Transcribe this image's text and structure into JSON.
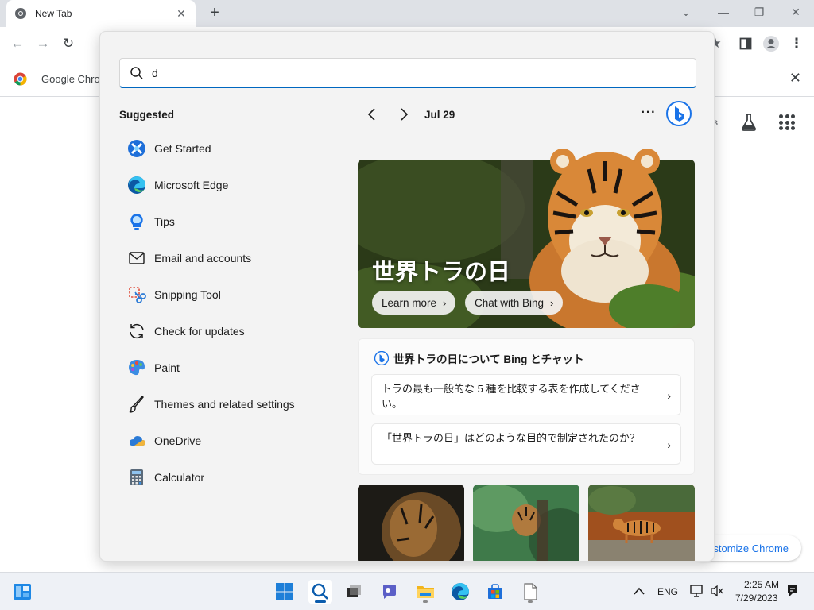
{
  "browser": {
    "tab_title": "New Tab",
    "bookmark_text": "Google Chro",
    "partial_text": "s",
    "customize_label": "stomize Chrome"
  },
  "search": {
    "query": "d"
  },
  "suggested": {
    "heading": "Suggested",
    "items": [
      {
        "label": "Get Started",
        "icon": "get-started-icon"
      },
      {
        "label": "Microsoft Edge",
        "icon": "edge-icon"
      },
      {
        "label": "Tips",
        "icon": "tips-icon"
      },
      {
        "label": "Email and accounts",
        "icon": "mail-icon"
      },
      {
        "label": "Snipping Tool",
        "icon": "snipping-tool-icon"
      },
      {
        "label": "Check for updates",
        "icon": "refresh-icon"
      },
      {
        "label": "Paint",
        "icon": "paint-icon"
      },
      {
        "label": "Themes and related settings",
        "icon": "brush-icon"
      },
      {
        "label": "OneDrive",
        "icon": "onedrive-icon"
      },
      {
        "label": "Calculator",
        "icon": "calculator-icon"
      }
    ]
  },
  "highlights": {
    "date": "Jul 29",
    "hero_title": "世界トラの日",
    "learn_more": "Learn more",
    "chat_with_bing": "Chat with Bing",
    "chat_heading": "世界トラの日について Bing とチャット",
    "chat_prompts": [
      "トラの最も一般的な 5 種を比較する表を作成してください。",
      "「世界トラの日」はどのような目的で制定されたのか？"
    ]
  },
  "taskbar": {
    "language": "ENG",
    "time": "2:25 AM",
    "date": "7/29/2023"
  },
  "colors": {
    "accent": "#0067c0",
    "panel_bg": "#f3f3f3"
  }
}
